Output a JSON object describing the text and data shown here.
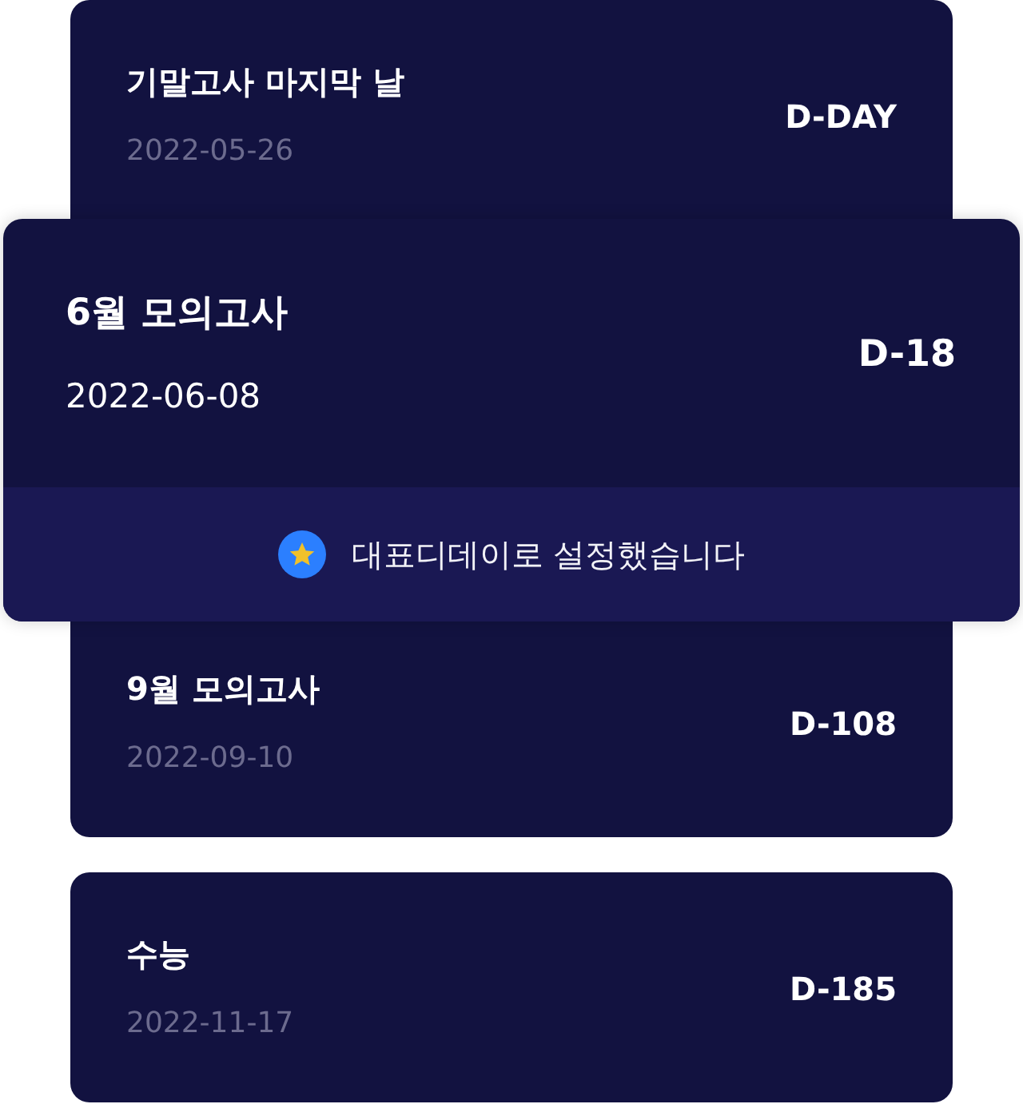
{
  "events": [
    {
      "title": "기말고사 마지막 날",
      "date": "2022-05-26",
      "countdown": "D-DAY",
      "featured": false
    },
    {
      "title": "6월 모의고사",
      "date": "2022-06-08",
      "countdown": "D-18",
      "featured": true,
      "notice": "대표디데이로 설정했습니다"
    },
    {
      "title": "9월 모의고사",
      "date": "2022-09-10",
      "countdown": "D-108",
      "featured": false
    },
    {
      "title": "수능",
      "date": "2022-11-17",
      "countdown": "D-185",
      "featured": false
    }
  ]
}
